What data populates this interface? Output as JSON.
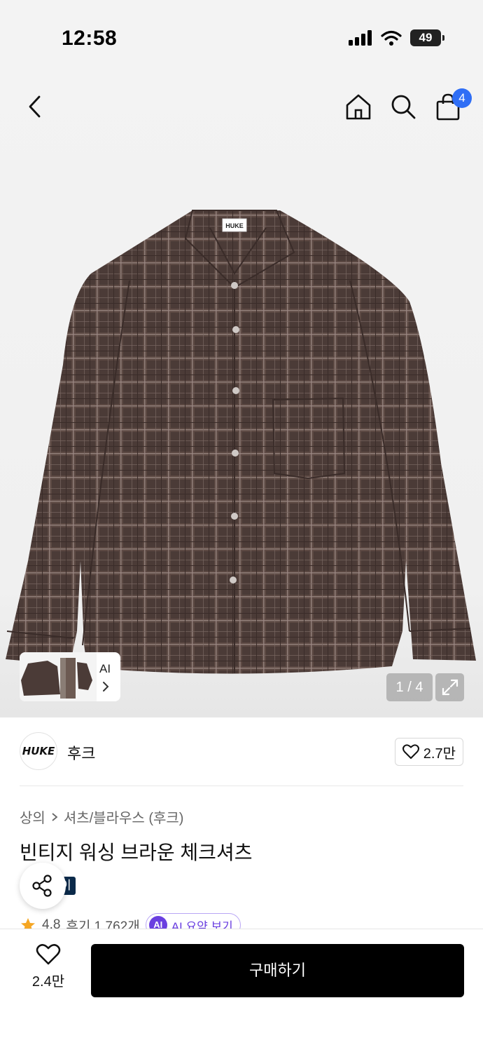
{
  "status_bar": {
    "time": "12:58",
    "battery": "49"
  },
  "nav": {
    "back_icon": "chevron-left-icon",
    "home_icon": "home-icon",
    "search_icon": "search-icon",
    "cart_icon": "shopping-bag-icon",
    "cart_count": "4"
  },
  "gallery": {
    "shirt_tag": "HUKE",
    "thumb_label": "AI",
    "page_counter": "1 / 4",
    "expand_icon": "expand-icon"
  },
  "brand": {
    "logo_text": "HUKE",
    "name": "후크",
    "like_count": "2.7만"
  },
  "product": {
    "breadcrumb": [
      "상의",
      "셔츠/블라우스 (후크)"
    ],
    "title": "빈티지 워싱 브라운 체크셔츠",
    "tag": "이",
    "rating": "4.8",
    "reviews": "후기 1,762개",
    "ai_badge": "AI",
    "ai_summary": "AI 요약 보기"
  },
  "bottom_bar": {
    "wish_count": "2.4만",
    "buy_label": "구매하기"
  },
  "colors": {
    "accent_blue": "#2f6ef5",
    "shirt_brown": "#4a3a36",
    "ai_purple": "#6a3fe0",
    "star": "#f5a623"
  }
}
